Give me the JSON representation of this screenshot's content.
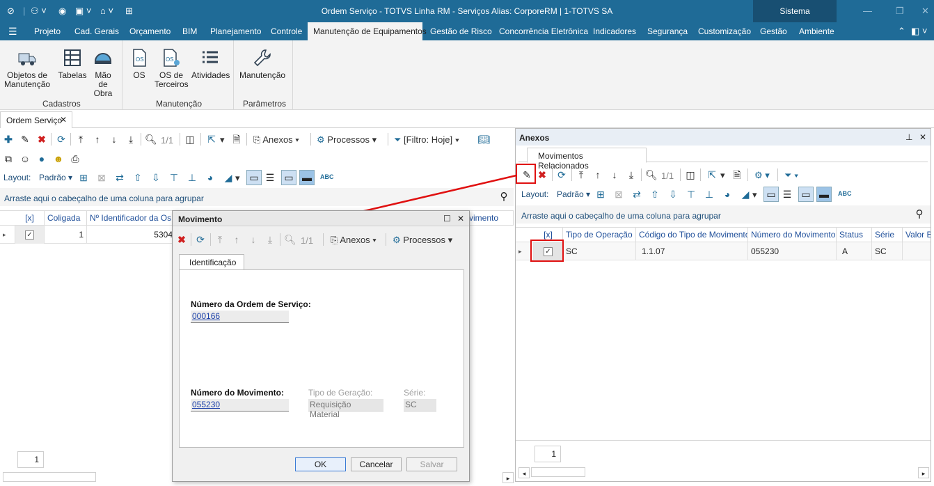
{
  "app": {
    "title": "Ordem Serviço - TOTVS Linha RM - Serviços  Alias: CorporeRM | 1-TOTVS SA",
    "system": "Sistema"
  },
  "menu": [
    "Projeto",
    "Cad. Gerais",
    "Orçamento",
    "BIM",
    "Planejamento",
    "Controle",
    "Manutenção de Equipamentos",
    "Gestão de Risco",
    "Concorrência Eletrônica",
    "Indicadores",
    "Segurança",
    "Customização",
    "Gestão",
    "Ambiente"
  ],
  "ribbon": {
    "buttons": [
      {
        "label": "Objetos de\nManutenção"
      },
      {
        "label": "Tabelas"
      },
      {
        "label": "Mão de\nObra"
      },
      {
        "label": "OS"
      },
      {
        "label": "OS de\nTerceiros"
      },
      {
        "label": "Atividades"
      },
      {
        "label": "Manutenção"
      }
    ],
    "groups": [
      "Cadastros",
      "Manutenção",
      "Parâmetros"
    ]
  },
  "doc_tab": "Ordem Serviço",
  "main": {
    "page": "1/1",
    "anexos": "Anexos",
    "processos": "Processos",
    "filter": "[Filtro: Hoje]",
    "layout_label": "Layout:",
    "layout_value": "Padrão",
    "abc": "ABC",
    "group_hint": "Arraste aqui o cabeçalho de uma coluna para agrupar",
    "columns": [
      "[x]",
      "Coligada",
      "Nº Identificador da Os",
      "vimento"
    ],
    "row": {
      "coligada": "1",
      "id": "5304"
    },
    "pager": "1"
  },
  "anexos_panel": {
    "title": "Anexos",
    "tab": "Movimentos Relacionados",
    "page": "1/1",
    "layout_label": "Layout:",
    "layout_value": "Padrão",
    "abc": "ABC",
    "group_hint": "Arraste aqui o cabeçalho de uma coluna para agrupar",
    "columns": [
      "[x]",
      "Tipo de Operação",
      "Código do Tipo de Movimento",
      "Número do Movimento",
      "Status",
      "Série",
      "Valor B"
    ],
    "row": {
      "tipo": "SC",
      "codigo": "1.1.07",
      "numero": "055230",
      "status": "A",
      "serie": "SC"
    },
    "pager": "1"
  },
  "dialog": {
    "title": "Movimento",
    "page": "1/1",
    "anexos": "Anexos",
    "processos": "Processos",
    "tab": "Identificação",
    "os_label": "Número da Ordem de Serviço:",
    "os_value": "000166",
    "mov_label": "Número do Movimento:",
    "mov_value": "055230",
    "tipo_label": "Tipo de Geração:",
    "tipo_value": "Requisição Material",
    "serie_label": "Série:",
    "serie_value": "SC",
    "ok": "OK",
    "cancel": "Cancelar",
    "save": "Salvar"
  },
  "colors": {
    "brand": "#1f6b97",
    "highlight": "#e01010",
    "link": "#1a3fa8"
  }
}
